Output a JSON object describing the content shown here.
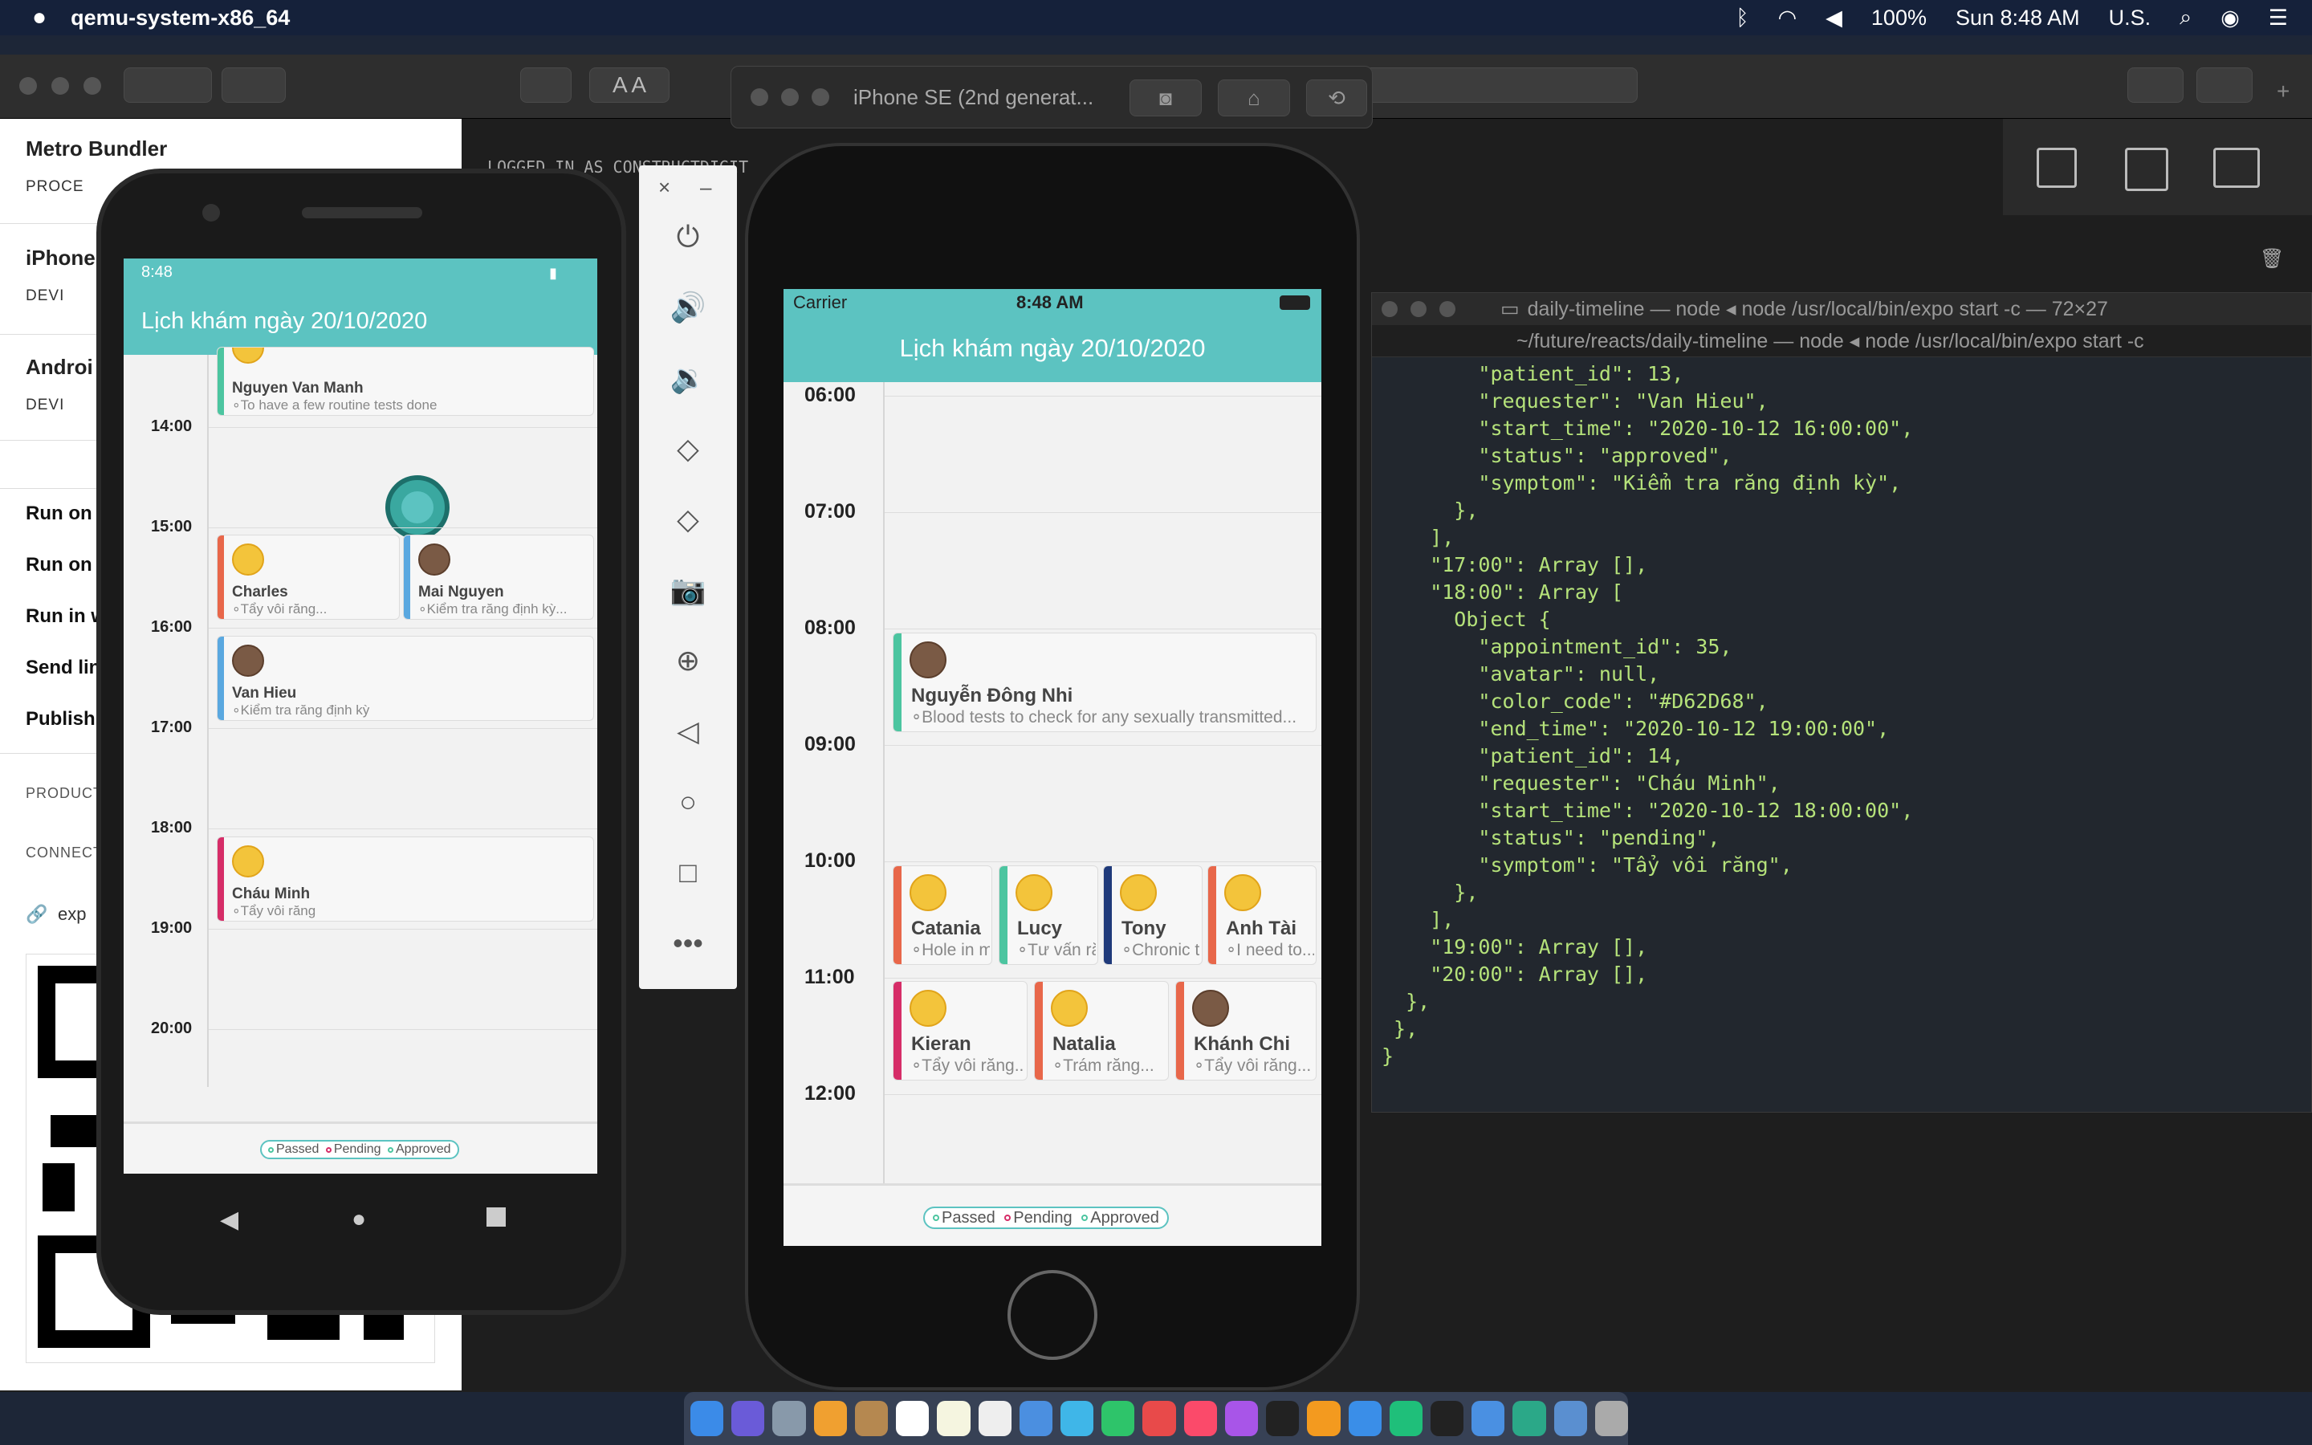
{
  "menubar": {
    "app_name": "qemu-system-x86_64",
    "battery": "100%",
    "clock": "Sun 8:48 AM",
    "input_source": "U.S."
  },
  "expo": {
    "title": "Metro Bundler",
    "process_label": "PROCE",
    "iphone_title": "iPhone",
    "iphone_device": "DEVI",
    "android_title": "Androi",
    "android_device": "DEVI",
    "run_items": [
      "Run on",
      "Run on",
      "Run in w",
      "Send lin",
      "Publish"
    ],
    "production_cap": "PRODUCT",
    "connection_cap": "CONNECT",
    "link_text": "exp",
    "logged_in": "LOGGED IN AS CONSTRUCTDIGIT"
  },
  "simulator": {
    "title": "iPhone SE (2nd generat..."
  },
  "iphone_app": {
    "carrier": "Carrier",
    "time": "8:48 AM",
    "header": "Lịch khám ngày 20/10/2020",
    "hours": [
      "06:00",
      "07:00",
      "08:00",
      "09:00",
      "10:00",
      "11:00",
      "12:00"
    ],
    "appointments": [
      {
        "name": "Nguyễn Đông Nhi",
        "symptom": "Blood tests to check for any sexually transmitted...",
        "color": "#4cc5a0"
      },
      {
        "name": "Catania",
        "symptom": "Hole in my",
        "color": "#e8674a"
      },
      {
        "name": "Lucy",
        "symptom": "Tư vấn răng",
        "color": "#4cc5a0"
      },
      {
        "name": "Tony",
        "symptom": "Chronic th",
        "color": "#1f3a7a"
      },
      {
        "name": "Anh Tài",
        "symptom": "I need to...",
        "color": "#e8674a"
      },
      {
        "name": "Kieran",
        "symptom": "Tẩy vôi răng...",
        "color": "#d62d68"
      },
      {
        "name": "Natalia",
        "symptom": "Trám răng...",
        "color": "#e8674a"
      },
      {
        "name": "Khánh Chi",
        "symptom": "Tẩy vôi răng...",
        "color": "#e8674a"
      }
    ],
    "legend": [
      "Passed",
      "Pending",
      "Approved"
    ]
  },
  "android_app": {
    "status_time": "8:48",
    "header": "Lịch khám ngày 20/10/2020",
    "hours": [
      "14:00",
      "15:00",
      "16:00",
      "17:00",
      "18:00",
      "19:00",
      "20:00"
    ],
    "appointments": [
      {
        "name": "Nguyen Van Manh",
        "symptom": "To have a few routine tests done",
        "color": "#4cc5a0"
      },
      {
        "name": "Charles",
        "symptom": "Tẩy vôi răng...",
        "color": "#e8674a"
      },
      {
        "name": "Mai Nguyen",
        "symptom": "Kiểm tra răng định kỳ...",
        "color": "#5aa8e0"
      },
      {
        "name": "Van Hieu",
        "symptom": "Kiểm tra răng định kỳ",
        "color": "#5aa8e0"
      },
      {
        "name": "Cháu Minh",
        "symptom": "Tẩy vôi răng",
        "color": "#d62d68"
      }
    ],
    "legend": [
      "Passed",
      "Pending",
      "Approved"
    ]
  },
  "terminal": {
    "title": "daily-timeline — node ◂ node /usr/local/bin/expo start -c — 72×27",
    "tab": "~/future/reacts/daily-timeline — node ◂ node /usr/local/bin/expo start -c",
    "lines": [
      "        \"patient_id\": 13,",
      "        \"requester\": \"Van Hieu\",",
      "        \"start_time\": \"2020-10-12 16:00:00\",",
      "        \"status\": \"approved\",",
      "        \"symptom\": \"Kiểm tra răng định kỳ\",",
      "      },",
      "    ],",
      "    \"17:00\": Array [],",
      "    \"18:00\": Array [",
      "      Object {",
      "        \"appointment_id\": 35,",
      "        \"avatar\": null,",
      "        \"color_code\": \"#D62D68\",",
      "        \"end_time\": \"2020-10-12 19:00:00\",",
      "        \"patient_id\": 14,",
      "        \"requester\": \"Cháu Minh\",",
      "        \"start_time\": \"2020-10-12 18:00:00\",",
      "        \"status\": \"pending\",",
      "        \"symptom\": \"Tẩy vôi răng\",",
      "      },",
      "    ],",
      "    \"19:00\": Array [],",
      "    \"20:00\": Array [],",
      "  },",
      " },",
      "}"
    ]
  },
  "colors": {
    "accent": "#5cc3c1",
    "passed": "#4cc5a0",
    "pending": "#d62d68",
    "approved": "#4cc5a0"
  }
}
